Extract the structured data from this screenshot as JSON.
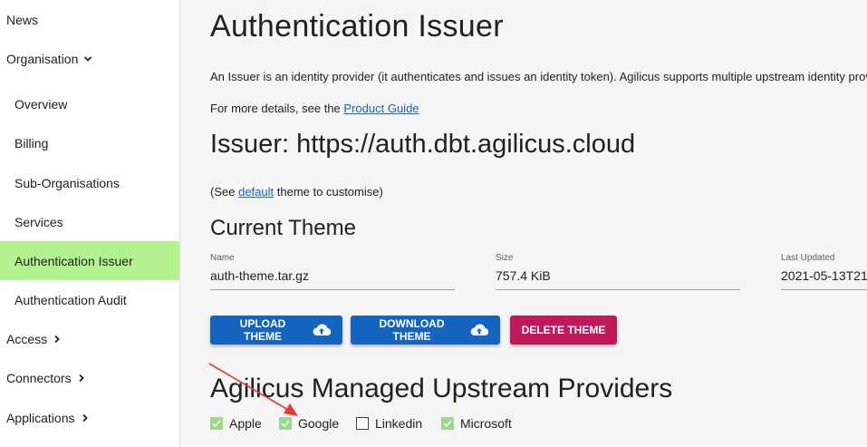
{
  "sidebar": {
    "items": [
      {
        "label": "News"
      },
      {
        "label": "Organisation"
      },
      {
        "label": "Overview"
      },
      {
        "label": "Billing"
      },
      {
        "label": "Sub-Organisations"
      },
      {
        "label": "Services"
      },
      {
        "label": "Authentication Issuer"
      },
      {
        "label": "Authentication Audit"
      },
      {
        "label": "Access"
      },
      {
        "label": "Connectors"
      },
      {
        "label": "Applications"
      }
    ]
  },
  "main": {
    "title": "Authentication Issuer",
    "intro": "An Issuer is an identity provider (it authenticates and issues an identity token). Agilicus supports multiple upstream identity providers.",
    "details_prefix": "For more details, see the",
    "details_link": "Product Guide",
    "issuer_heading": "Issuer: https://auth.dbt.agilicus.cloud",
    "see_prefix": "(See",
    "see_link": "default",
    "see_suffix": "theme to customise)",
    "current_theme_heading": "Current Theme",
    "fields": {
      "name_label": "Name",
      "name_value": "auth-theme.tar.gz",
      "size_label": "Size",
      "size_value": "757.4 KiB",
      "updated_label": "Last Updated",
      "updated_value": "2021-05-13T21"
    },
    "buttons": {
      "upload": "UPLOAD THEME",
      "download": "DOWNLOAD THEME",
      "delete": "DELETE THEME"
    },
    "providers_heading": "Agilicus Managed Upstream Providers",
    "providers": [
      {
        "label": "Apple",
        "checked": true
      },
      {
        "label": "Google",
        "checked": true
      },
      {
        "label": "Linkedin",
        "checked": false
      },
      {
        "label": "Microsoft",
        "checked": true
      }
    ]
  },
  "colors": {
    "active_nav": "#b2f290",
    "primary": "#1565c0",
    "danger": "#c2185b",
    "annotation_arrow": "#e53935"
  }
}
